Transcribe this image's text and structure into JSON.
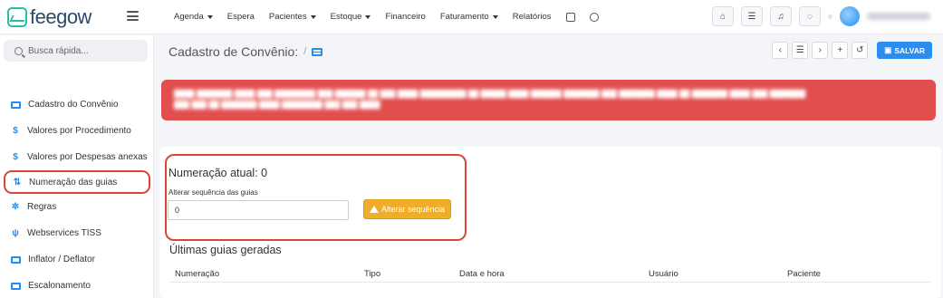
{
  "brand": {
    "name": "feegow",
    "accent": "#1f8ff2",
    "highlight": "#d9443b"
  },
  "topnav": {
    "items": [
      {
        "label": "Agenda",
        "caret": true
      },
      {
        "label": "Espera",
        "caret": false
      },
      {
        "label": "Pacientes",
        "caret": true
      },
      {
        "label": "Estoque",
        "caret": true
      },
      {
        "label": "Financeiro",
        "caret": false
      },
      {
        "label": "Faturamento",
        "caret": true
      },
      {
        "label": "Relatórios",
        "caret": false
      }
    ],
    "icons": [
      "database-icon",
      "gear-icon"
    ],
    "tools": [
      "inbox-icon",
      "list-check-icon",
      "bell-icon",
      "chat-icon"
    ]
  },
  "sidebar": {
    "search_placeholder": "Busca rápida...",
    "items": [
      {
        "label": "Cadastro do Convênio",
        "icon": "card-icon"
      },
      {
        "label": "Valores por Procedimento",
        "icon": "dollar-icon"
      },
      {
        "label": "Valores por Despesas anexas",
        "icon": "dollar-icon"
      },
      {
        "label": "Numeração das guias",
        "icon": "sort-icon",
        "active": true
      },
      {
        "label": "Regras",
        "icon": "cogs-icon"
      },
      {
        "label": "Webservices TISS",
        "icon": "plug-icon"
      },
      {
        "label": "Inflator / Deflator",
        "icon": "money-icon"
      },
      {
        "label": "Escalonamento",
        "icon": "money-icon"
      }
    ]
  },
  "header": {
    "title": "Cadastro de Convênio:",
    "separator": "/",
    "save_label": "SALVAR"
  },
  "main": {
    "current_numbering": "Numeração atual: 0",
    "change_label": "Alterar sequência das guias",
    "input_value": "0",
    "change_button": "Alterar sequência",
    "last_guides_title": "Últimas guias geradas",
    "columns": [
      "Numeração",
      "Tipo",
      "Data e hora",
      "Usuário",
      "Paciente"
    ]
  }
}
